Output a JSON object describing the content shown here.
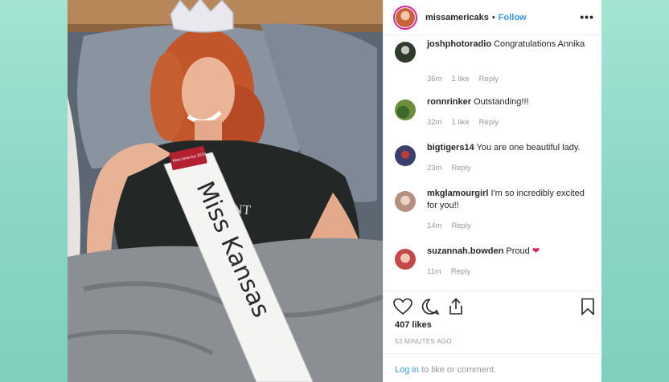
{
  "post": {
    "username": "missamericaks",
    "separator": "•",
    "follow_label": "Follow",
    "more_label": "•••",
    "likes": "407 likes",
    "time_ago": "53 MINUTES AGO",
    "login_link": "Log in",
    "login_rest": " to like or comment.",
    "photo": {
      "sash_text": "Miss Kansas",
      "shirt_text": "PAGEANT",
      "badge_text": "Miss America 2019"
    }
  },
  "comments": [
    {
      "user": "joshphotoradio",
      "text": "Congratulations Annika",
      "time": "36m",
      "likes": "1 like",
      "reply": "Reply",
      "avatar_color": "#2f3a2a"
    },
    {
      "user": "ronnrinker",
      "text": "Outstanding!!!",
      "time": "32m",
      "likes": "1 like",
      "reply": "Reply",
      "avatar_color": "#6a8e3a"
    },
    {
      "user": "bigtigers14",
      "text": "You are one beautiful lady.",
      "time": "23m",
      "likes": "",
      "reply": "Reply",
      "avatar_color": "#3a3f6b"
    },
    {
      "user": "mkglamourgirl",
      "text": "I'm so incredibly excited for you!!",
      "time": "14m",
      "likes": "",
      "reply": "Reply",
      "avatar_color": "#b49080"
    },
    {
      "user": "suzannah.bowden",
      "text": "Proud",
      "time": "11m",
      "likes": "",
      "reply": "Reply",
      "avatar_color": "#c4484a"
    }
  ],
  "icons": {
    "like": "heart-icon",
    "comment": "comment-icon",
    "share": "share-icon",
    "save": "bookmark-icon",
    "heart_emoji": "red-heart-emoji"
  },
  "colors": {
    "link_blue": "#3897f0",
    "text_dark": "#262626",
    "text_gray": "#999999",
    "background_teal": "#8fd9c9"
  }
}
